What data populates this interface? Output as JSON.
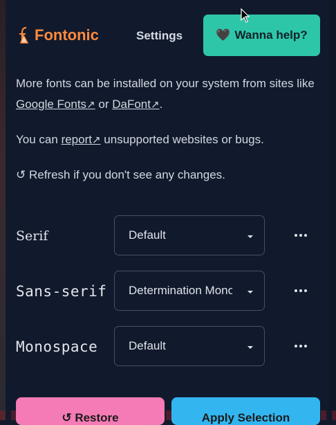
{
  "header": {
    "logo_text": "Fontonic",
    "settings_label": "Settings",
    "help_label": "Wanna help?",
    "help_emoji": "🖤"
  },
  "info": {
    "line1_text": "More fonts can be installed on your system from sites like",
    "google_fonts_link": "Google Fonts",
    "or_text": "or",
    "dafont_link": "DaFont",
    "period": ".",
    "report_prefix": "You can",
    "report_link": "report",
    "report_suffix": "unsupported websites or bugs.",
    "refresh_text": "↺ Refresh if you don't see any changes.",
    "link_arrow": "↗"
  },
  "font_rows": [
    {
      "label": "Serif",
      "selected": "Default"
    },
    {
      "label": "Sans-serif",
      "selected": "Determination Mono"
    },
    {
      "label": "Monospace",
      "selected": "Default"
    }
  ],
  "buttons": {
    "restore_label": "↺ Restore",
    "apply_label": "Apply Selection"
  },
  "colors": {
    "background": "#111a2c",
    "brand": "#ff8a3d",
    "help_button": "#2ec6a9",
    "restore_button": "#f47bb5",
    "apply_button": "#33b6f0"
  },
  "icons": {
    "logo": "font-glyph-icon",
    "dropdown": "chevron-down-icon",
    "more": "more-dots-icon"
  }
}
